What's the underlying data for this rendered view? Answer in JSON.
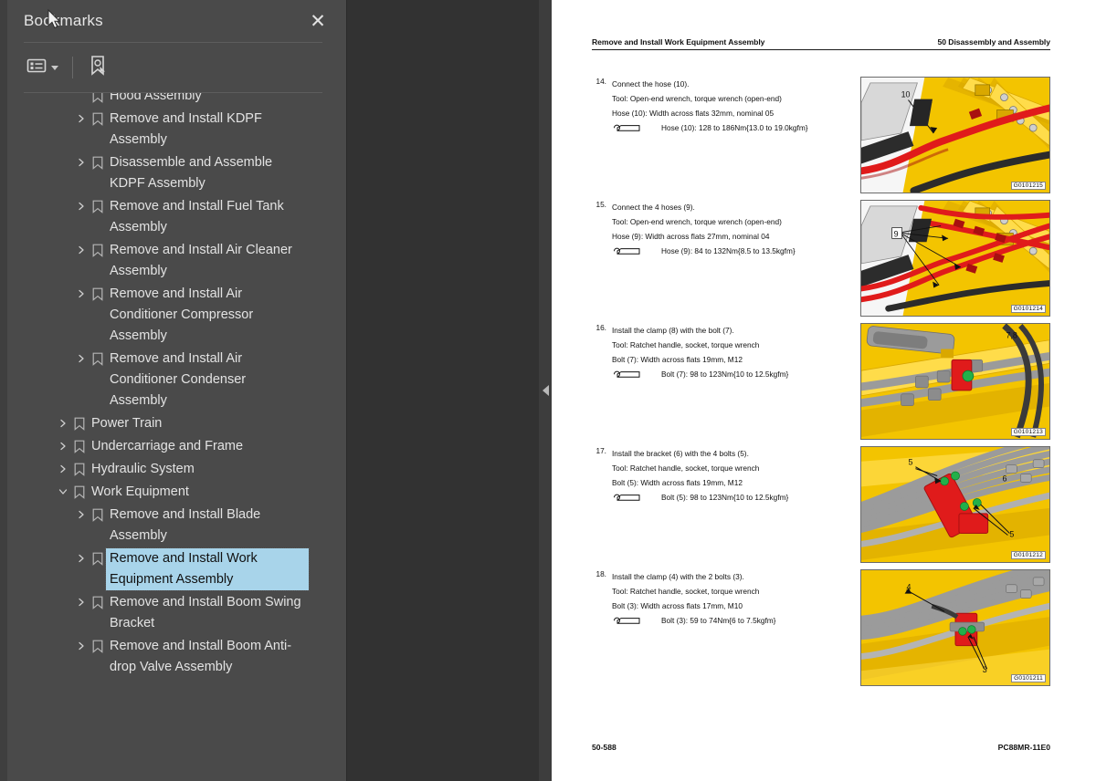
{
  "panel": {
    "title": "Bookmarks",
    "close_label": "✕",
    "toolbar": {
      "options_icon": "list-options-icon",
      "new_bookmark_icon": "new-bookmark-icon"
    },
    "tree": [
      {
        "label": "Hood Assembly",
        "level": 2,
        "expandable": false,
        "selected": false,
        "clipped": true
      },
      {
        "label": "Remove and Install KDPF Assembly",
        "level": 2,
        "expandable": true,
        "selected": false
      },
      {
        "label": "Disassemble and Assemble KDPF Assembly",
        "level": 2,
        "expandable": true,
        "selected": false
      },
      {
        "label": "Remove and Install Fuel Tank Assembly",
        "level": 2,
        "expandable": true,
        "selected": false
      },
      {
        "label": "Remove and Install Air Cleaner Assembly",
        "level": 2,
        "expandable": true,
        "selected": false
      },
      {
        "label": "Remove and Install Air Conditioner Compressor Assembly",
        "level": 2,
        "expandable": true,
        "selected": false
      },
      {
        "label": "Remove and Install Air Conditioner Condenser Assembly",
        "level": 2,
        "expandable": true,
        "selected": false
      },
      {
        "label": "Power Train",
        "level": 1,
        "expandable": true,
        "selected": false
      },
      {
        "label": "Undercarriage and Frame",
        "level": 1,
        "expandable": true,
        "selected": false
      },
      {
        "label": "Hydraulic System",
        "level": 1,
        "expandable": true,
        "selected": false
      },
      {
        "label": "Work Equipment",
        "level": 1,
        "expandable": true,
        "expanded": true,
        "selected": false
      },
      {
        "label": "Remove and Install Blade Assembly",
        "level": 2,
        "expandable": true,
        "selected": false
      },
      {
        "label": "Remove and Install Work Equipment Assembly",
        "level": 2,
        "expandable": true,
        "selected": true
      },
      {
        "label": "Remove and Install Boom Swing Bracket",
        "level": 2,
        "expandable": true,
        "selected": false
      },
      {
        "label": "Remove and Install Boom Anti-drop Valve Assembly",
        "level": 2,
        "expandable": true,
        "selected": false
      }
    ]
  },
  "collapse_handle": {
    "icon": "chevron-left-icon"
  },
  "document": {
    "header": {
      "left": "Remove and Install Work Equipment Assembly",
      "right": "50 Disassembly and Assembly"
    },
    "footer": {
      "left": "50-588",
      "right": "PC88MR-11E0"
    },
    "steps": [
      {
        "num": "14.",
        "lines": [
          "Connect the hose (10).",
          "Tool: Open-end wrench, torque wrench (open-end)",
          "Hose (10): Width across flats 32mm, nominal 05"
        ],
        "torque": "Hose (10): 128 to 186Nm{13.0 to 19.0kgfm}",
        "figure_id": "G0101215",
        "figure_callouts": [
          "10"
        ]
      },
      {
        "num": "15.",
        "lines": [
          "Connect the 4 hoses (9).",
          "Tool: Open-end wrench, torque wrench (open-end)",
          "Hose (9): Width across flats 27mm, nominal 04"
        ],
        "torque": "Hose (9): 84 to 132Nm{8.5 to 13.5kgfm}",
        "figure_id": "G0101214",
        "figure_callouts": [
          "9"
        ]
      },
      {
        "num": "16.",
        "lines": [
          "Install the clamp (8) with the bolt (7).",
          "Tool: Ratchet handle, socket, torque wrench",
          "Bolt (7): Width across flats 19mm, M12"
        ],
        "torque": "Bolt (7): 98 to 123Nm{10 to 12.5kgfm}",
        "figure_id": "G0101213",
        "figure_callouts": [
          "7,8"
        ]
      },
      {
        "num": "17.",
        "lines": [
          "Install the bracket (6) with the 4 bolts (5).",
          "Tool: Ratchet handle, socket, torque wrench",
          "Bolt (5): Width across flats 19mm, M12"
        ],
        "torque": "Bolt (5): 98 to 123Nm{10 to 12.5kgfm}",
        "figure_id": "G0101212",
        "figure_callouts": [
          "5",
          "6",
          "5"
        ]
      },
      {
        "num": "18.",
        "lines": [
          "Install the clamp (4) with the 2 bolts (3).",
          "Tool: Ratchet handle, socket, torque wrench",
          "Bolt (3): Width across flats 17mm, M10"
        ],
        "torque": "Bolt (3): 59 to 74Nm{6 to 7.5kgfm}",
        "figure_id": "G0101211",
        "figure_callouts": [
          "4",
          "3"
        ]
      }
    ]
  },
  "colors": {
    "panel_bg": "#4a4a4a",
    "selection": "#a8d4ea",
    "page_bg": "#ffffff",
    "app_bg": "#323232",
    "machine_yellow": "#f5c400",
    "hose_red": "#e02020",
    "clamp_red": "#d81f1f",
    "hose_gray": "#9a9a9a"
  }
}
